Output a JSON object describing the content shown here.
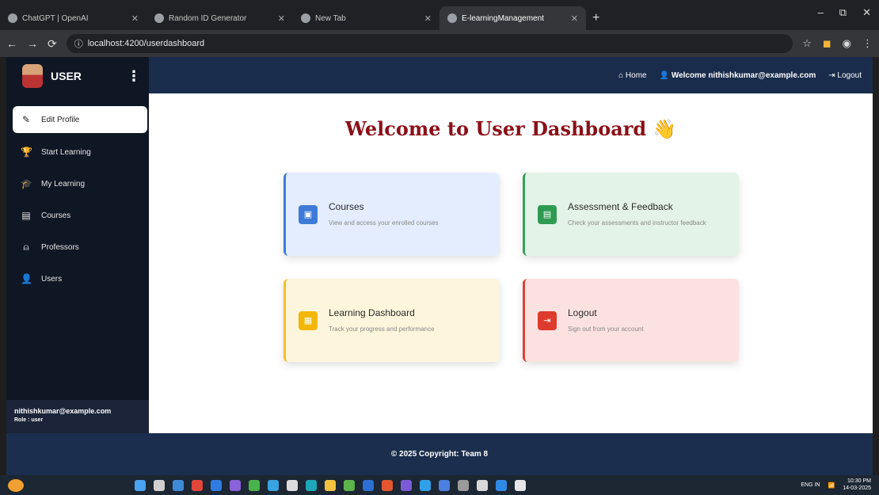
{
  "browser": {
    "tabs": [
      {
        "title": "ChatGPT | OpenAI",
        "active": false
      },
      {
        "title": "Random ID Generator",
        "active": false
      },
      {
        "title": "New Tab",
        "active": false
      },
      {
        "title": "E-learningManagement",
        "active": true
      }
    ],
    "new_tab": "+",
    "url": "localhost:4200/userdashboard",
    "nav": {
      "back": "←",
      "forward": "→",
      "reload": "⟳"
    },
    "window_controls": {
      "minimize": "–",
      "maximize": "⧉",
      "close": "✕"
    }
  },
  "sidebar": {
    "title": "USER",
    "menu_icon": "⋮",
    "items": [
      {
        "label": "Edit Profile",
        "icon": "✎"
      },
      {
        "label": "Start Learning",
        "icon": "🏆"
      },
      {
        "label": "My Learning",
        "icon": "🎓"
      },
      {
        "label": "Courses",
        "icon": "▤"
      },
      {
        "label": "Professors",
        "icon": "⍝"
      },
      {
        "label": "Users",
        "icon": "👤"
      }
    ],
    "footer_email": "nithishkumar@example.com",
    "footer_role": "Role : user"
  },
  "topnav": {
    "home": "Home",
    "welcome": "Welcome nithishkumar@example.com",
    "logout": "Logout"
  },
  "main": {
    "title": "Welcome to User Dashboard",
    "hand": "👋",
    "cards": [
      {
        "title": "Courses",
        "desc": "View and access your enrolled courses",
        "icon": "▣",
        "color": "#3e7bd8"
      },
      {
        "title": "Assessment & Feedback",
        "desc": "Check your assessments and instructor feedback",
        "icon": "▤",
        "color": "#2f9b52"
      },
      {
        "title": "Learning Dashboard",
        "desc": "Track your progress and performance",
        "icon": "▦",
        "color": "#f3b70a"
      },
      {
        "title": "Logout",
        "desc": "Sign out from your account",
        "icon": "⇥",
        "color": "#dd3b2d"
      }
    ]
  },
  "footer": {
    "text": "© 2025 Copyright: Team 8"
  },
  "taskbar": {
    "lang": "ENG IN",
    "time": "10:30 PM",
    "date": "14-03-2025"
  }
}
